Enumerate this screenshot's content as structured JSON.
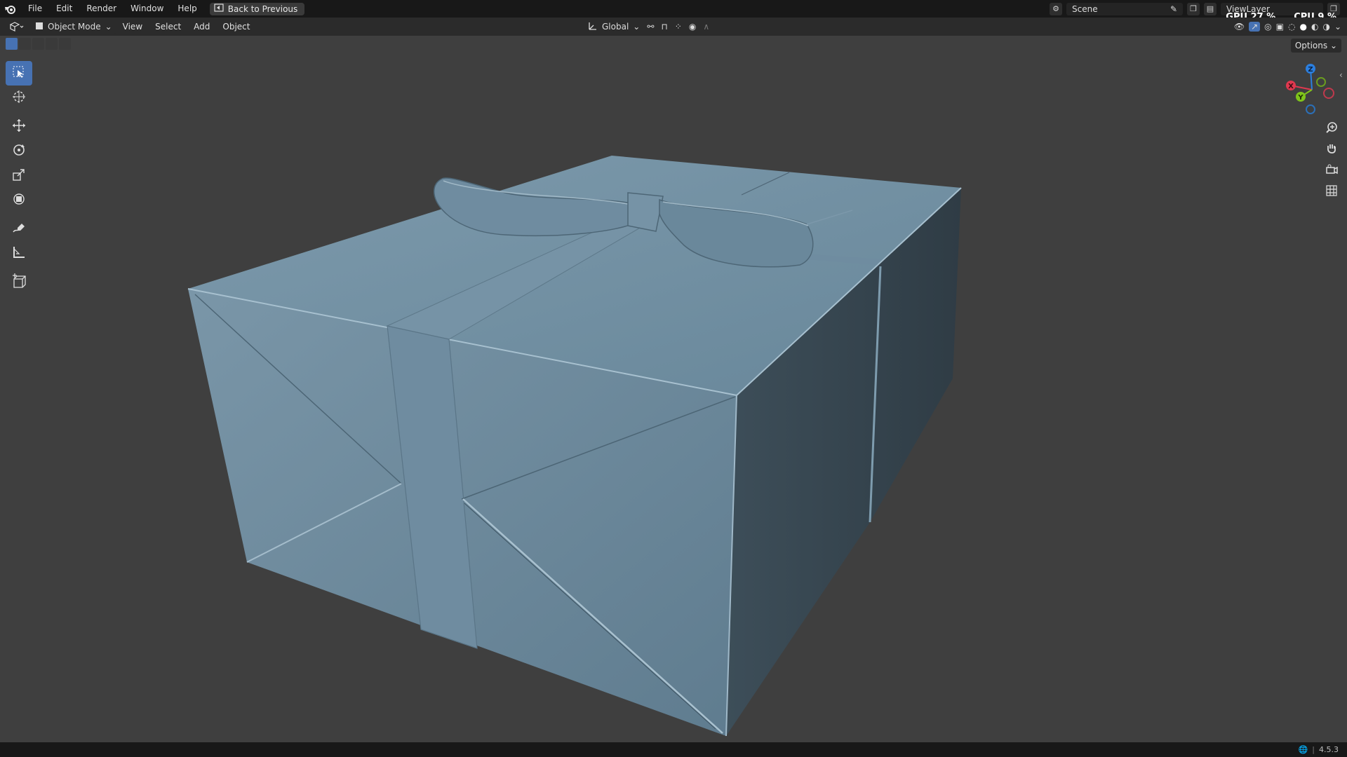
{
  "menubar": {
    "items": [
      "File",
      "Edit",
      "Render",
      "Window",
      "Help"
    ],
    "back_button": "Back to Previous"
  },
  "top_right": {
    "scene_name": "Scene",
    "view_layer": "ViewLayer",
    "gpu_label": "GPU",
    "gpu_value": "27 %",
    "cpu_label": "CPU",
    "cpu_value": "9 %"
  },
  "header": {
    "mode": "Object Mode",
    "menus": [
      "View",
      "Select",
      "Add",
      "Object"
    ],
    "transform_orientation": "Global",
    "options": "Options"
  },
  "gizmo": {
    "x_label": "X",
    "y_label": "Y",
    "z_label": "Z",
    "x_color": "#e0384f",
    "y_color": "#7fc41b",
    "z_color": "#2b7fe0"
  },
  "toolbar_tools": [
    "select-box",
    "cursor",
    "move",
    "rotate",
    "scale",
    "transform",
    "annotate",
    "measure",
    "add-cube"
  ],
  "statusbar": {
    "version": "4.5.3"
  },
  "colors": {
    "viewport_bg": "#3f3f3f",
    "model_color": "#6e8b9d",
    "accent": "#4772b3"
  }
}
